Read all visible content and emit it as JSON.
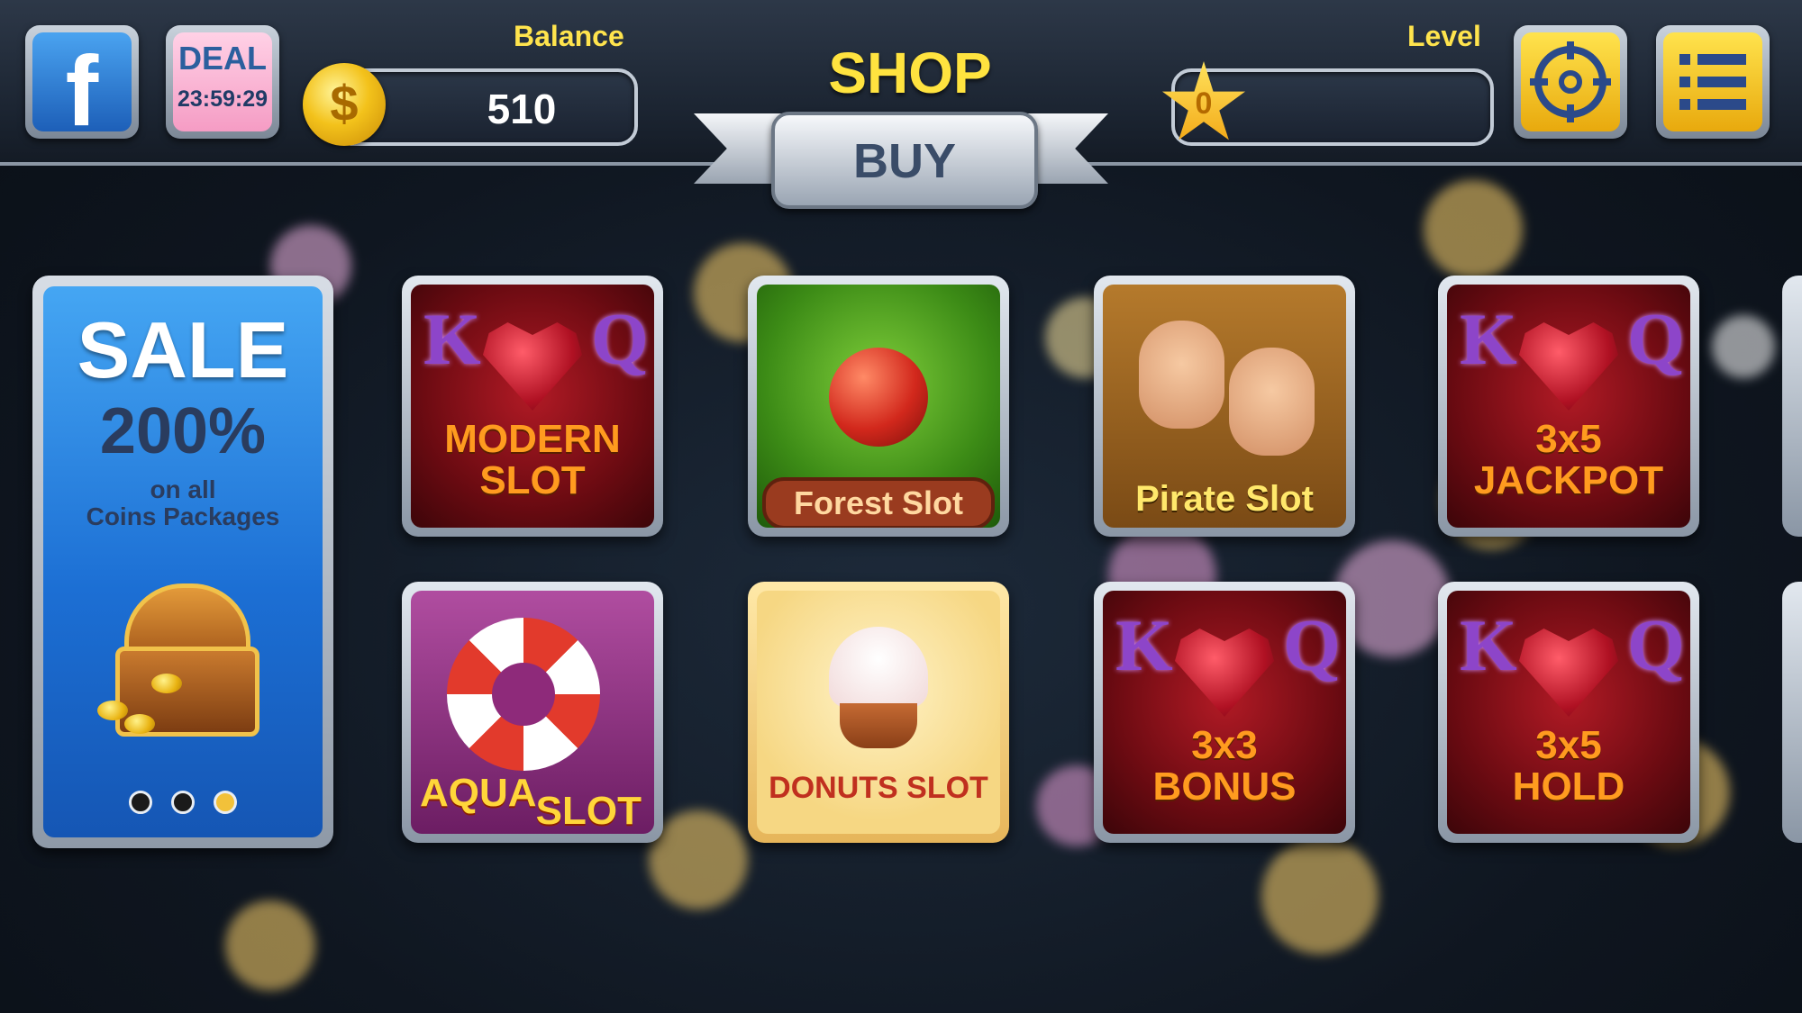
{
  "header": {
    "facebook_label": "f",
    "deal": {
      "title": "DEAL",
      "timer": "23:59:29"
    },
    "balance_label": "Balance",
    "balance_value": "510",
    "coin_symbol": "$",
    "shop_title": "SHOP",
    "buy_label": "BUY",
    "level_label": "Level",
    "level_value": "0"
  },
  "sale_card": {
    "title": "SALE",
    "percent": "200%",
    "line1": "on all",
    "line2": "Coins Packages",
    "pages": 3,
    "active_page": 3
  },
  "tiles": {
    "modern": {
      "line1": "MODERN",
      "line2": "SLOT"
    },
    "forest": {
      "name": "Forest Slot"
    },
    "pirate": {
      "name": "Pirate Slot"
    },
    "jackpot": {
      "line1": "3x5",
      "line2": "JACKPOT"
    },
    "aqua": {
      "word1": "AQUA",
      "word2": "SLOT"
    },
    "donuts": {
      "name": "DONUTS SLOT"
    },
    "bonus": {
      "line1": "3x3",
      "line2": "BONUS"
    },
    "hold": {
      "line1": "3x5",
      "line2": "HOLD"
    }
  },
  "kq": {
    "k": "K",
    "q": "Q"
  },
  "colors": {
    "accent_yellow": "#ffe33f",
    "facebook_blue": "#1d5fb8",
    "sale_blue": "#1c6fd4",
    "slot_red": "#b11a25"
  },
  "icons": {
    "facebook": "facebook-icon",
    "coin": "coin-icon",
    "star": "star-icon",
    "settings": "settings-icon",
    "menu": "menu-list-icon"
  }
}
